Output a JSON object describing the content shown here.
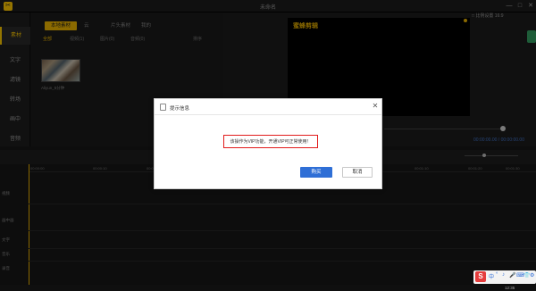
{
  "app": {
    "title": "未命名",
    "logo_glyph": "✂",
    "resolution": "□ 比例设置 16:9"
  },
  "window_controls": [
    "—",
    "□",
    "✕"
  ],
  "sidenav": {
    "items": [
      {
        "label": "素材",
        "active": true
      },
      {
        "label": "文字",
        "active": false
      },
      {
        "label": "滤镜",
        "active": false
      },
      {
        "label": "转场",
        "active": false
      },
      {
        "label": "画中",
        "active": false
      },
      {
        "label": "音频",
        "active": false
      }
    ]
  },
  "media": {
    "import_label": "本地素材",
    "top_tabs": [
      "云",
      "片头素材",
      "我的"
    ],
    "sub_tabs": [
      "全部",
      "视频(1)",
      "图片(0)",
      "音频(0)"
    ],
    "sort_label": "排序",
    "thumb_caption": "Aliyun_5分钟"
  },
  "preview": {
    "brand": "蜜蜂剪辑",
    "timecode": "00:00:00.00 / 00:00:00.00"
  },
  "timeline": {
    "ticks": [
      "00:00:00",
      "00:00:10",
      "00:00:20",
      "00:00:30",
      "00:00:40",
      "00:00:50",
      "00:01:00",
      "00:01:10",
      "00:01:20",
      "00:01:30"
    ],
    "tracks": [
      "视频",
      "画中画",
      "文字",
      "音乐",
      "录音"
    ]
  },
  "dialog": {
    "title": "提示信息",
    "close_glyph": "✕",
    "message": "该操作为VIP功能，开通VIP可正常使用！",
    "buy_label": "购买",
    "cancel_label": "取消",
    "highlight_color": "#e11b1b",
    "primary_color": "#2f6fd6"
  },
  "tray": {
    "ime_glyph": "S",
    "items": [
      "中",
      "°",
      "♪",
      "🎤",
      "⌨",
      "👕",
      "⚙"
    ],
    "clock": "12:35"
  },
  "colors": {
    "accent": "#d6a400",
    "background": "#141414"
  }
}
